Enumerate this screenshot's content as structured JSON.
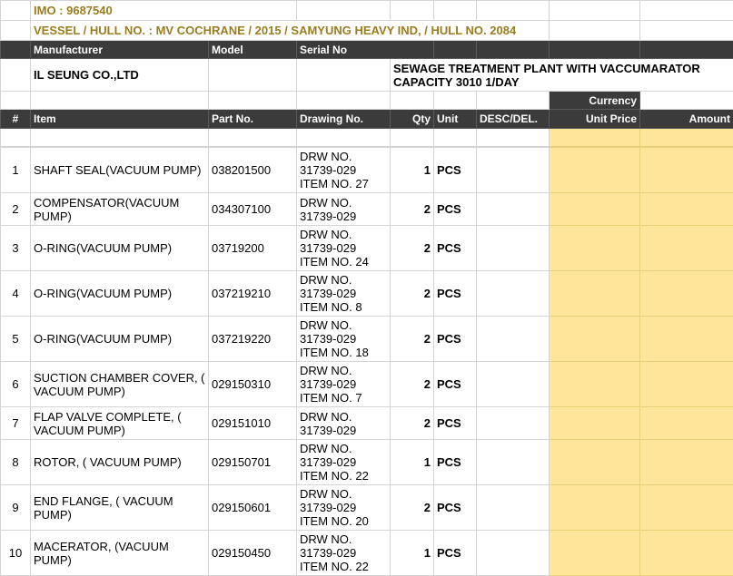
{
  "imo": "IMO : 9687540",
  "vessel": "VESSEL / HULL NO. : MV COCHRANE / 2015 / SAMYUNG HEAVY IND, / HULL NO. 2084",
  "meta_headers": {
    "manufacturer": "Manufacturer",
    "model": "Model",
    "serial": "Serial No"
  },
  "manufacturer": "IL SEUNG CO.,LTD",
  "description": "SEWAGE TREATMENT PLANT WITH VACCUMARATOR CAPACITY 3010 1/DAY",
  "currency_label": "Currency",
  "columns": {
    "num": "#",
    "item": "Item",
    "part": "Part No.",
    "drawing": "Drawing No.",
    "qty": "Qty",
    "unit": "Unit",
    "desc": "DESC/DEL.",
    "price": "Unit Price",
    "amount": "Amount"
  },
  "rows": [
    {
      "num": "1",
      "item": "SHAFT SEAL(VACUUM PUMP)",
      "part": "038201500",
      "drawing": "DRW NO. 31739-029 ITEM NO. 27",
      "qty": "1",
      "unit": "PCS"
    },
    {
      "num": "2",
      "item": "COMPENSATOR(VACUUM PUMP)",
      "part": "034307100",
      "drawing": "DRW NO. 31739-029",
      "qty": "2",
      "unit": "PCS"
    },
    {
      "num": "3",
      "item": "O-RING(VACUUM PUMP)",
      "part": "03719200",
      "drawing": "DRW NO. 31739-029 ITEM NO. 24",
      "qty": "2",
      "unit": "PCS"
    },
    {
      "num": "4",
      "item": "O-RING(VACUUM PUMP)",
      "part": "037219210",
      "drawing": "DRW NO. 31739-029 ITEM NO. 8",
      "qty": "2",
      "unit": "PCS"
    },
    {
      "num": "5",
      "item": "O-RING(VACUUM PUMP)",
      "part": "037219220",
      "drawing": "DRW NO. 31739-029 ITEM NO. 18",
      "qty": "2",
      "unit": "PCS"
    },
    {
      "num": "6",
      "item": "SUCTION CHAMBER COVER, ( VACUUM PUMP)",
      "part": "029150310",
      "drawing": "DRW NO. 31739-029 ITEM NO. 7",
      "qty": "2",
      "unit": "PCS"
    },
    {
      "num": "7",
      "item": "FLAP VALVE COMPLETE, ( VACUUM PUMP)",
      "part": "029151010",
      "drawing": "DRW NO. 31739-029",
      "qty": "2",
      "unit": "PCS"
    },
    {
      "num": "8",
      "item": "ROTOR, ( VACUUM PUMP)",
      "part": "029150701",
      "drawing": "DRW NO. 31739-029 ITEM NO. 22",
      "qty": "1",
      "unit": "PCS"
    },
    {
      "num": "9",
      "item": "END FLANGE, ( VACUUM PUMP)",
      "part": "029150601",
      "drawing": "DRW NO. 31739-029 ITEM NO. 20",
      "qty": "2",
      "unit": "PCS"
    },
    {
      "num": "10",
      "item": "MACERATOR, (VACUUM PUMP)",
      "part": "029150450",
      "drawing": "DRW NO. 31739-029 ITEM NO. 22",
      "qty": "1",
      "unit": "PCS"
    }
  ],
  "colors": {
    "header_bg": "#3b3b3b",
    "price_fill": "#ffe599",
    "gold_text": "#9a7d1e"
  }
}
